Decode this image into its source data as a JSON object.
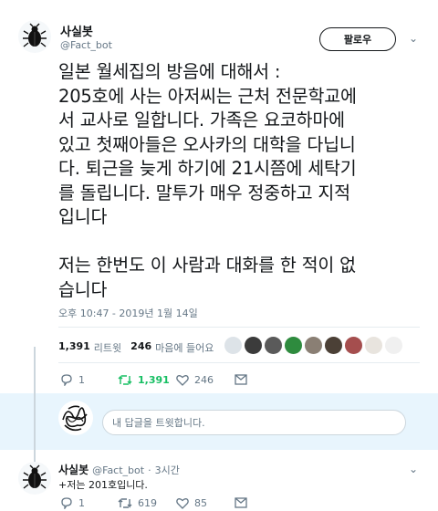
{
  "tweet": {
    "author_name": "사실봇",
    "author_handle": "@Fact_bot",
    "follow_label": "팔로우",
    "text": "일본 월세집의 방음에 대해서 :\n205호에 사는 아저씨는 근처 전문학교에\n서 교사로 일합니다. 가족은 요코하마에\n있고 첫째아들은 오사카의 대학을 다닙니\n다. 퇴근을 늦게 하기에 21시쯤에 세탁기\n를 돌립니다. 말투가 매우 정중하고 지적\n입니다\n\n저는 한번도 이 사람과 대화를 한 적이 없\n습니다",
    "timestamp": "오후 10:47 - 2019년 1월 14일",
    "retweet_count": "1,391",
    "retweet_label": "리트윗",
    "like_count": "246",
    "like_label": "마음에 들어요",
    "actions": {
      "reply_count": "1",
      "retweet_count": "1,391",
      "like_count": "246"
    }
  },
  "reply_composer": {
    "placeholder": "내 답글을 트윗합니다."
  },
  "reply": {
    "author_name": "사실봇",
    "author_handle": "@Fact_bot",
    "time": "3시간",
    "text": "+저는 201호입니다.",
    "actions": {
      "reply_count": "1",
      "retweet_count": "619",
      "like_count": "85"
    }
  },
  "colors": {
    "retweet_active": "#17bf63",
    "muted": "#657786",
    "text": "#14171a",
    "divider": "#e6ecf0"
  }
}
